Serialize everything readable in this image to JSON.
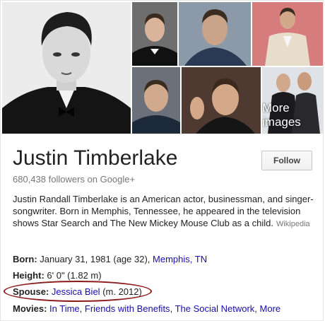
{
  "images": {
    "more_label": "More images"
  },
  "entity": {
    "name": "Justin Timberlake",
    "followers": "680,438 followers on Google+"
  },
  "follow_button": "Follow",
  "description": {
    "text": "Justin Randall Timberlake is an American actor, businessman, and singer-songwriter. Born in Memphis, Tennessee, he appeared in the television shows Star Search and The New Mickey Mouse Club as a child.",
    "source": "Wikipedia"
  },
  "facts": {
    "born": {
      "label": "Born:",
      "value": "January 31, 1981 (age 32),",
      "link": "Memphis, TN"
    },
    "height": {
      "label": "Height:",
      "value": "6' 0\" (1.82 m)"
    },
    "spouse": {
      "label": "Spouse:",
      "link": "Jessica Biel",
      "value": "(m. 2012)"
    },
    "movies": {
      "label": "Movies:",
      "links": [
        "In Time",
        "Friends with Benefits",
        "The Social Network",
        "More"
      ]
    }
  },
  "colors": {
    "link": "#1a0dab",
    "highlight_oval": "#8b1a1a"
  }
}
